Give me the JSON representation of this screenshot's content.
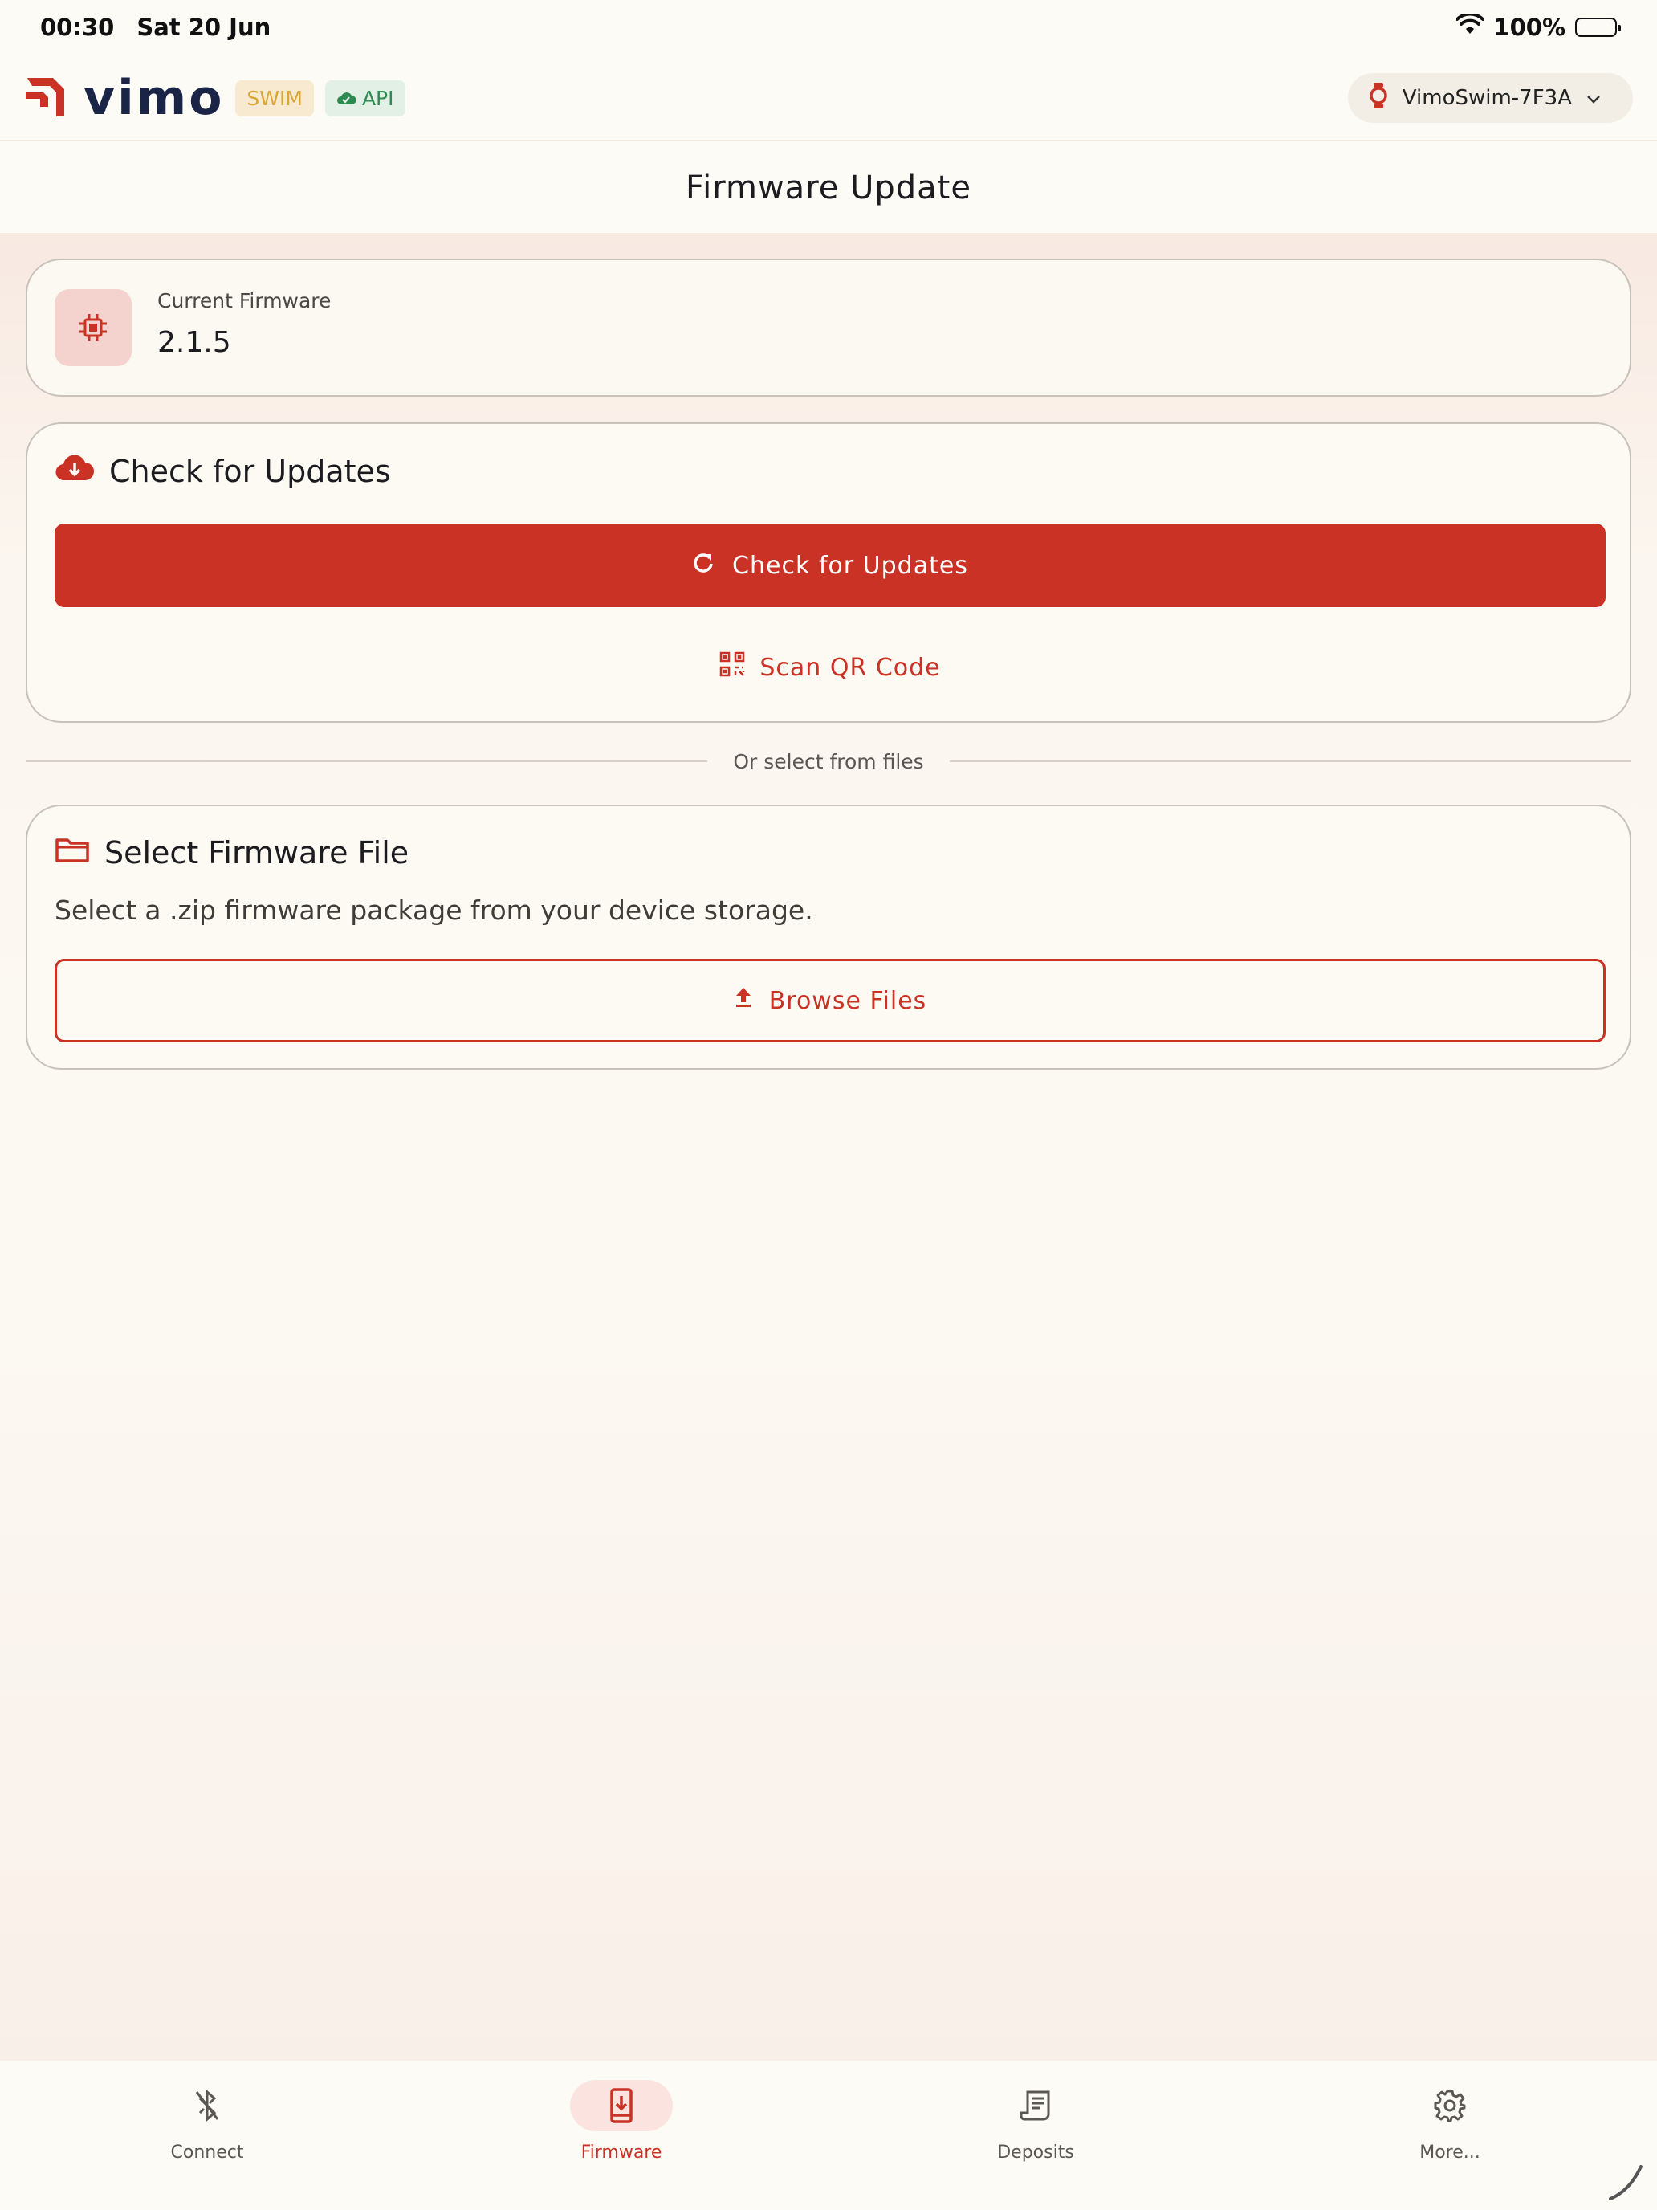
{
  "status": {
    "time": "00:30",
    "date": "Sat 20 Jun",
    "battery": "100%"
  },
  "header": {
    "brand": "vimo",
    "badge_swim": "SWIM",
    "badge_api": "API",
    "device_name": "VimoSwim-7F3A"
  },
  "page": {
    "title": "Firmware Update"
  },
  "current_firmware": {
    "label": "Current Firmware",
    "version": "2.1.5"
  },
  "updates": {
    "heading": "Check for Updates",
    "check_button": "Check for Updates",
    "scan_button": "Scan QR Code"
  },
  "divider": {
    "text": "Or select from files"
  },
  "file_select": {
    "heading": "Select Firmware File",
    "description": "Select a .zip firmware package from your device storage.",
    "browse_button": "Browse Files"
  },
  "nav": [
    {
      "label": "Connect",
      "icon": "bluetooth-off-icon",
      "active": false
    },
    {
      "label": "Firmware",
      "icon": "firmware-download-icon",
      "active": true
    },
    {
      "label": "Deposits",
      "icon": "receipt-icon",
      "active": false
    },
    {
      "label": "More...",
      "icon": "gear-icon",
      "active": false
    }
  ],
  "colors": {
    "accent": "#c93225",
    "brand_navy": "#1a2446",
    "swim_badge": "#d9a536",
    "api_badge": "#2d8a50"
  }
}
